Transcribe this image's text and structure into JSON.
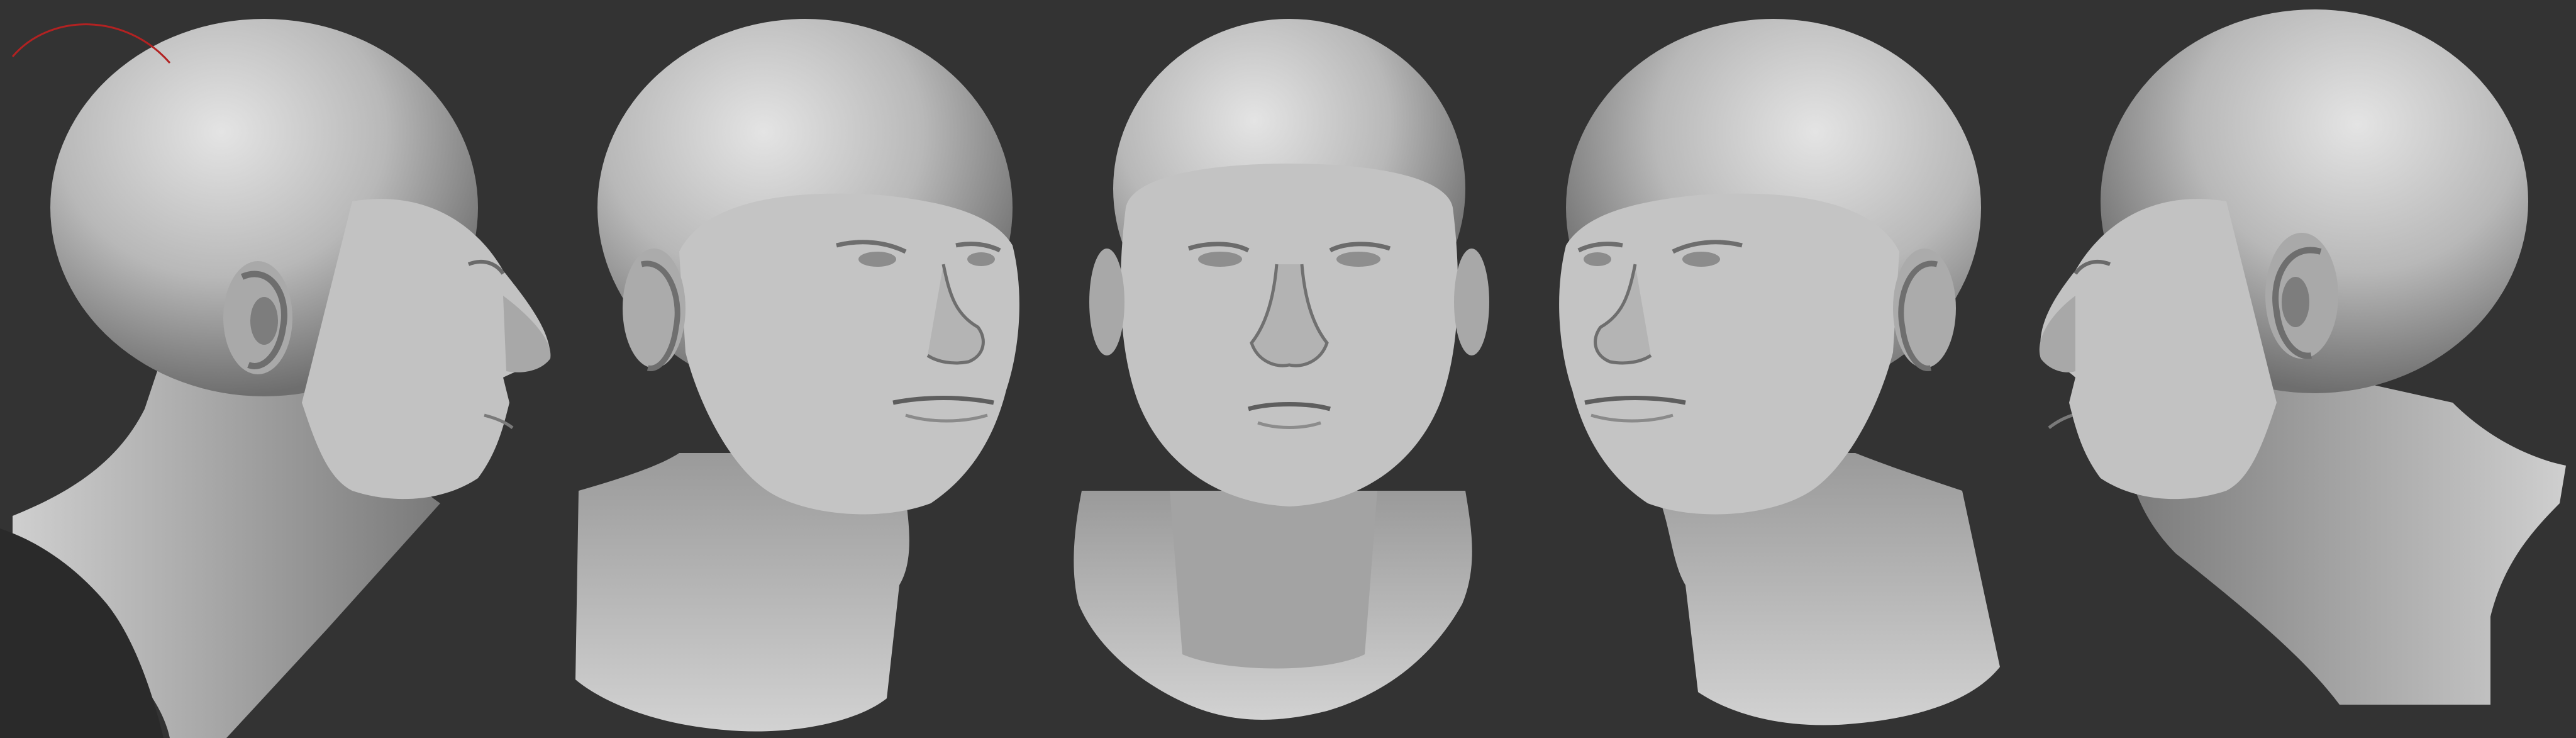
{
  "scene": {
    "background_color": "#333333",
    "clay_color": "#bdbdbd",
    "clay_shadow": "#5a5a5a",
    "clay_highlight": "#e6e6e6",
    "gizmo_color": "#b22222"
  },
  "views": [
    {
      "name": "right-profile",
      "facing": "right"
    },
    {
      "name": "right-three-quarter",
      "facing": "right"
    },
    {
      "name": "front",
      "facing": "front"
    },
    {
      "name": "left-three-quarter",
      "facing": "left"
    },
    {
      "name": "left-profile",
      "facing": "left"
    }
  ]
}
